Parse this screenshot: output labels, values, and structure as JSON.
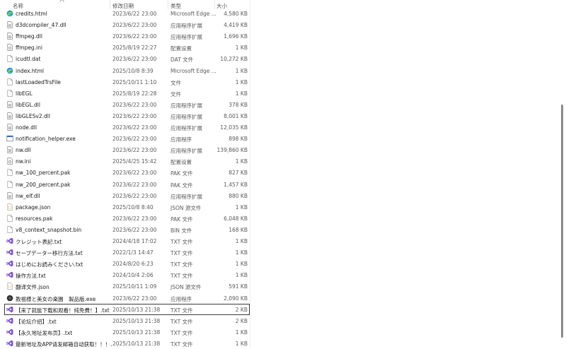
{
  "header": {
    "name": "名称",
    "date": "修改日期",
    "type": "类型",
    "size": "大小"
  },
  "files": [
    {
      "name": "credits.html",
      "date": "2023/6/22 23:00",
      "type": "Microsoft Edge ...",
      "size": "4,580 KB",
      "icon": "edge-icon"
    },
    {
      "name": "d3dcompiler_47.dll",
      "date": "2023/6/22 23:00",
      "type": "应用程序扩展",
      "size": "4,419 KB",
      "icon": "dll-icon"
    },
    {
      "name": "ffmpeg.dll",
      "date": "2023/6/22 23:00",
      "type": "应用程序扩展",
      "size": "1,696 KB",
      "icon": "dll-icon"
    },
    {
      "name": "ffmpeg.ini",
      "date": "2025/8/19 22:27",
      "type": "配置设置",
      "size": "1 KB",
      "icon": "ini-icon"
    },
    {
      "name": "icudtl.dat",
      "date": "2023/6/22 23:00",
      "type": "DAT 文件",
      "size": "10,272 KB",
      "icon": "file-icon"
    },
    {
      "name": "index.html",
      "date": "2025/10/8 8:39",
      "type": "Microsoft Edge ...",
      "size": "1 KB",
      "icon": "edge-icon"
    },
    {
      "name": "lastLoadedTrsFile",
      "date": "2025/10/11 1:10",
      "type": "文件",
      "size": "1 KB",
      "icon": "file-icon"
    },
    {
      "name": "libEGL",
      "date": "2025/8/19 22:28",
      "type": "文件",
      "size": "1 KB",
      "icon": "file-icon"
    },
    {
      "name": "libEGL.dll",
      "date": "2023/6/22 23:00",
      "type": "应用程序扩展",
      "size": "378 KB",
      "icon": "dll-icon"
    },
    {
      "name": "libGLESv2.dll",
      "date": "2023/6/22 23:00",
      "type": "应用程序扩展",
      "size": "8,001 KB",
      "icon": "dll-icon"
    },
    {
      "name": "node.dll",
      "date": "2023/6/22 23:00",
      "type": "应用程序扩展",
      "size": "12,035 KB",
      "icon": "dll-icon"
    },
    {
      "name": "notification_helper.exe",
      "date": "2023/6/22 23:00",
      "type": "应用程序",
      "size": "898 KB",
      "icon": "exe-icon"
    },
    {
      "name": "nw.dll",
      "date": "2023/6/22 23:00",
      "type": "应用程序扩展",
      "size": "139,860 KB",
      "icon": "dll-icon"
    },
    {
      "name": "nw.ini",
      "date": "2025/4/25 15:42",
      "type": "配置设置",
      "size": "1 KB",
      "icon": "ini-icon"
    },
    {
      "name": "nw_100_percent.pak",
      "date": "2023/6/22 23:00",
      "type": "PAK 文件",
      "size": "827 KB",
      "icon": "file-icon"
    },
    {
      "name": "nw_200_percent.pak",
      "date": "2023/6/22 23:00",
      "type": "PAK 文件",
      "size": "1,457 KB",
      "icon": "file-icon"
    },
    {
      "name": "nw_elf.dll",
      "date": "2023/6/22 23:00",
      "type": "应用程序扩展",
      "size": "880 KB",
      "icon": "dll-icon"
    },
    {
      "name": "package.json",
      "date": "2025/10/8 8:40",
      "type": "JSON 源文件",
      "size": "1 KB",
      "icon": "json-icon"
    },
    {
      "name": "resources.pak",
      "date": "2023/6/22 23:00",
      "type": "PAK 文件",
      "size": "6,048 KB",
      "icon": "file-icon"
    },
    {
      "name": "v8_context_snapshot.bin",
      "date": "2023/6/22 23:00",
      "type": "BIN 文件",
      "size": "168 KB",
      "icon": "file-icon"
    },
    {
      "name": "クレジット表記.txt",
      "date": "2024/4/18 17:02",
      "type": "TXT 文件",
      "size": "1 KB",
      "icon": "vs-icon"
    },
    {
      "name": "セーブデーター移行方法.txt",
      "date": "2022/1/3 14:47",
      "type": "TXT 文件",
      "size": "1 KB",
      "icon": "vs-icon"
    },
    {
      "name": "はじめにお読みください.txt",
      "date": "2024/8/20 6:23",
      "type": "TXT 文件",
      "size": "1 KB",
      "icon": "vs-icon"
    },
    {
      "name": "操作方法.txt",
      "date": "2024/10/4 2:06",
      "type": "TXT 文件",
      "size": "1 KB",
      "icon": "vs-icon"
    },
    {
      "name": "翻译文件.json",
      "date": "2025/10/11 1:09",
      "type": "JSON 源文件",
      "size": "591 KB",
      "icon": "json-icon"
    },
    {
      "name": "教祖様と美女の楽園　製品版.exe",
      "date": "2023/6/22 23:00",
      "type": "应用程序",
      "size": "2,090 KB",
      "icon": "app-icon"
    },
    {
      "name": "【来了就能下载和观看！纯免費！】.txt",
      "date": "2025/10/13 21:38",
      "type": "TXT 文件",
      "size": "2 KB",
      "icon": "vs-icon",
      "selected": true
    },
    {
      "name": "【论坛介绍】.txt",
      "date": "2025/10/13 21:38",
      "type": "TXT 文件",
      "size": "2 KB",
      "icon": "vs-icon"
    },
    {
      "name": "【永久地址发布页】.txt",
      "date": "2025/10/13 21:38",
      "type": "TXT 文件",
      "size": "1 KB",
      "icon": "vs-icon"
    },
    {
      "name": "最新地址及APP请发邮箱自动获取！！！...",
      "date": "2025/10/13 21:38",
      "type": "TXT 文件",
      "size": "1 KB",
      "icon": "vs-icon"
    }
  ],
  "colors": {
    "edge": "#1b8fd6",
    "vs": "#7b4fd0",
    "selected_outline": "#3a3a3a"
  }
}
